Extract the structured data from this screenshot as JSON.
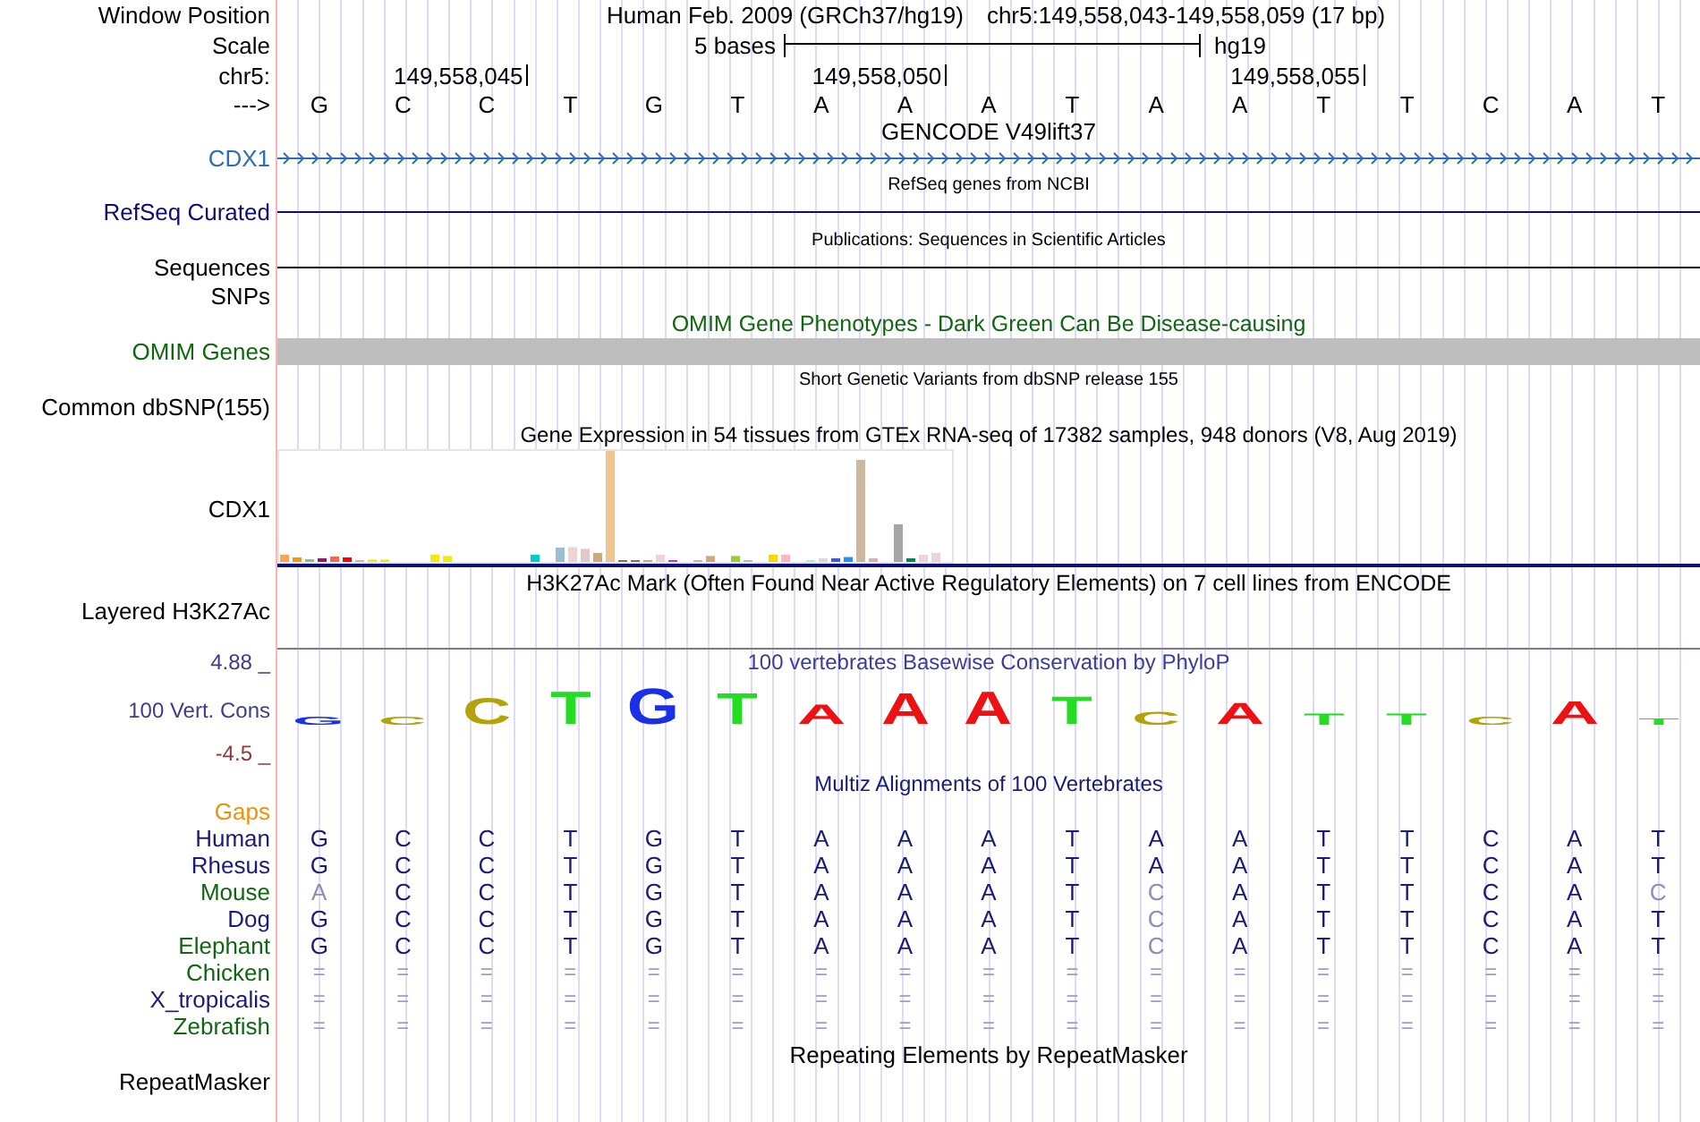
{
  "window_position": {
    "label": "Window Position",
    "assembly": "Human Feb. 2009 (GRCh37/hg19)",
    "region": "chr5:149,558,043-149,558,059 (17 bp)"
  },
  "scale": {
    "label": "Scale",
    "length": "5 bases",
    "assembly": "hg19"
  },
  "ruler": {
    "label": "chr5:",
    "positions": [
      "149,558,045",
      "149,558,050",
      "149,558,055"
    ]
  },
  "sequence": {
    "label": "--->",
    "bases": [
      "G",
      "C",
      "C",
      "T",
      "G",
      "T",
      "A",
      "A",
      "A",
      "T",
      "A",
      "A",
      "T",
      "T",
      "C",
      "A",
      "T"
    ]
  },
  "gencode": {
    "title": "GENCODE V49lift37",
    "label": "CDX1"
  },
  "refseq": {
    "title": "RefSeq genes from NCBI",
    "label": "RefSeq Curated"
  },
  "publications": {
    "title": "Publications: Sequences in Scientific Articles",
    "label": "Sequences"
  },
  "snps": {
    "label": "SNPs"
  },
  "omim": {
    "title": "OMIM Gene Phenotypes - Dark Green Can Be Disease-causing",
    "label": "OMIM Genes"
  },
  "dbsnp": {
    "title": "Short Genetic Variants from dbSNP release 155",
    "label": "Common dbSNP(155)"
  },
  "gtex": {
    "title": "Gene Expression in 54 tissues from GTEx RNA-seq of 17382 samples, 948 donors (V8, Aug 2019)",
    "label": "CDX1"
  },
  "h3k27ac": {
    "title": "H3K27Ac Mark (Often Found Near Active Regulatory Elements) on 7 cell lines from ENCODE",
    "label": "Layered H3K27Ac"
  },
  "conservation": {
    "title": "100 vertebrates Basewise Conservation by PhyloP",
    "label": "100 Vert. Cons",
    "scale_max": "4.88 _",
    "scale_min": "-4.5 _",
    "logo": [
      {
        "base": "G",
        "color": "#1a30e8"
      },
      {
        "base": "C",
        "color": "#b3a20a"
      },
      {
        "base": "C",
        "color": "#b3a20a"
      },
      {
        "base": "T",
        "color": "#22dd22"
      },
      {
        "base": "G",
        "color": "#1a30e8"
      },
      {
        "base": "T",
        "color": "#22dd22"
      },
      {
        "base": "A",
        "color": "#ee1111"
      },
      {
        "base": "A",
        "color": "#ee1111"
      },
      {
        "base": "A",
        "color": "#ee1111"
      },
      {
        "base": "T",
        "color": "#22dd22"
      },
      {
        "base": "C",
        "color": "#b3a20a"
      },
      {
        "base": "A",
        "color": "#ee1111"
      },
      {
        "base": "T",
        "color": "#22dd22"
      },
      {
        "base": "T",
        "color": "#22dd22"
      },
      {
        "base": "C",
        "color": "#b3a20a"
      },
      {
        "base": "A",
        "color": "#ee1111"
      },
      {
        "base": "T",
        "color": "#22dd22"
      }
    ]
  },
  "multiz": {
    "title": "Multiz Alignments of 100 Vertebrates",
    "gaps_label": "Gaps",
    "species": [
      {
        "name": "Human",
        "color": "#1a1a78",
        "kind": "bases",
        "cells": [
          {
            "base": "G",
            "mismatch": false
          },
          {
            "base": "C",
            "mismatch": false
          },
          {
            "base": "C",
            "mismatch": false
          },
          {
            "base": "T",
            "mismatch": false
          },
          {
            "base": "G",
            "mismatch": false
          },
          {
            "base": "T",
            "mismatch": false
          },
          {
            "base": "A",
            "mismatch": false
          },
          {
            "base": "A",
            "mismatch": false
          },
          {
            "base": "A",
            "mismatch": false
          },
          {
            "base": "T",
            "mismatch": false
          },
          {
            "base": "A",
            "mismatch": false
          },
          {
            "base": "A",
            "mismatch": false
          },
          {
            "base": "T",
            "mismatch": false
          },
          {
            "base": "T",
            "mismatch": false
          },
          {
            "base": "C",
            "mismatch": false
          },
          {
            "base": "A",
            "mismatch": false
          },
          {
            "base": "T",
            "mismatch": false
          }
        ]
      },
      {
        "name": "Rhesus",
        "color": "#1a1a78",
        "kind": "bases",
        "cells": [
          {
            "base": "G",
            "mismatch": false
          },
          {
            "base": "C",
            "mismatch": false
          },
          {
            "base": "C",
            "mismatch": false
          },
          {
            "base": "T",
            "mismatch": false
          },
          {
            "base": "G",
            "mismatch": false
          },
          {
            "base": "T",
            "mismatch": false
          },
          {
            "base": "A",
            "mismatch": false
          },
          {
            "base": "A",
            "mismatch": false
          },
          {
            "base": "A",
            "mismatch": false
          },
          {
            "base": "T",
            "mismatch": false
          },
          {
            "base": "A",
            "mismatch": false
          },
          {
            "base": "A",
            "mismatch": false
          },
          {
            "base": "T",
            "mismatch": false
          },
          {
            "base": "T",
            "mismatch": false
          },
          {
            "base": "C",
            "mismatch": false
          },
          {
            "base": "A",
            "mismatch": false
          },
          {
            "base": "T",
            "mismatch": false
          }
        ]
      },
      {
        "name": "Mouse",
        "color": "#116611",
        "kind": "bases",
        "cells": [
          {
            "base": "A",
            "mismatch": true
          },
          {
            "base": "C",
            "mismatch": false
          },
          {
            "base": "C",
            "mismatch": false
          },
          {
            "base": "T",
            "mismatch": false
          },
          {
            "base": "G",
            "mismatch": false
          },
          {
            "base": "T",
            "mismatch": false
          },
          {
            "base": "A",
            "mismatch": false
          },
          {
            "base": "A",
            "mismatch": false
          },
          {
            "base": "A",
            "mismatch": false
          },
          {
            "base": "T",
            "mismatch": false
          },
          {
            "base": "C",
            "mismatch": true
          },
          {
            "base": "A",
            "mismatch": false
          },
          {
            "base": "T",
            "mismatch": false
          },
          {
            "base": "T",
            "mismatch": false
          },
          {
            "base": "C",
            "mismatch": false
          },
          {
            "base": "A",
            "mismatch": false
          },
          {
            "base": "C",
            "mismatch": true
          }
        ]
      },
      {
        "name": "Dog",
        "color": "#1a1a78",
        "kind": "bases",
        "cells": [
          {
            "base": "G",
            "mismatch": false
          },
          {
            "base": "C",
            "mismatch": false
          },
          {
            "base": "C",
            "mismatch": false
          },
          {
            "base": "T",
            "mismatch": false
          },
          {
            "base": "G",
            "mismatch": false
          },
          {
            "base": "T",
            "mismatch": false
          },
          {
            "base": "A",
            "mismatch": false
          },
          {
            "base": "A",
            "mismatch": false
          },
          {
            "base": "A",
            "mismatch": false
          },
          {
            "base": "T",
            "mismatch": false
          },
          {
            "base": "C",
            "mismatch": true
          },
          {
            "base": "A",
            "mismatch": false
          },
          {
            "base": "T",
            "mismatch": false
          },
          {
            "base": "T",
            "mismatch": false
          },
          {
            "base": "C",
            "mismatch": false
          },
          {
            "base": "A",
            "mismatch": false
          },
          {
            "base": "T",
            "mismatch": false
          }
        ]
      },
      {
        "name": "Elephant",
        "color": "#116611",
        "kind": "bases",
        "cells": [
          {
            "base": "G",
            "mismatch": false
          },
          {
            "base": "C",
            "mismatch": false
          },
          {
            "base": "C",
            "mismatch": false
          },
          {
            "base": "T",
            "mismatch": false
          },
          {
            "base": "G",
            "mismatch": false
          },
          {
            "base": "T",
            "mismatch": false
          },
          {
            "base": "A",
            "mismatch": false
          },
          {
            "base": "A",
            "mismatch": false
          },
          {
            "base": "A",
            "mismatch": false
          },
          {
            "base": "T",
            "mismatch": false
          },
          {
            "base": "C",
            "mismatch": true
          },
          {
            "base": "A",
            "mismatch": false
          },
          {
            "base": "T",
            "mismatch": false
          },
          {
            "base": "T",
            "mismatch": false
          },
          {
            "base": "C",
            "mismatch": false
          },
          {
            "base": "A",
            "mismatch": false
          },
          {
            "base": "T",
            "mismatch": false
          }
        ]
      },
      {
        "name": "Chicken",
        "color": "#116611",
        "kind": "gaps",
        "cells": [
          "=",
          "=",
          "=",
          "=",
          "=",
          "=",
          "=",
          "=",
          "=",
          "=",
          "=",
          "=",
          "=",
          "=",
          "=",
          "=",
          "="
        ]
      },
      {
        "name": "X_tropicalis",
        "color": "#1a1a78",
        "kind": "gaps",
        "cells": [
          "=",
          "=",
          "=",
          "=",
          "=",
          "=",
          "=",
          "=",
          "=",
          "=",
          "=",
          "=",
          "=",
          "=",
          "=",
          "=",
          "="
        ]
      },
      {
        "name": "Zebrafish",
        "color": "#116611",
        "kind": "gaps",
        "cells": [
          "=",
          "=",
          "=",
          "=",
          "=",
          "=",
          "=",
          "=",
          "=",
          "=",
          "=",
          "=",
          "=",
          "=",
          "=",
          "=",
          "="
        ]
      }
    ]
  },
  "repeatmasker": {
    "title": "Repeating Elements by RepeatMasker",
    "label": "RepeatMasker"
  }
}
